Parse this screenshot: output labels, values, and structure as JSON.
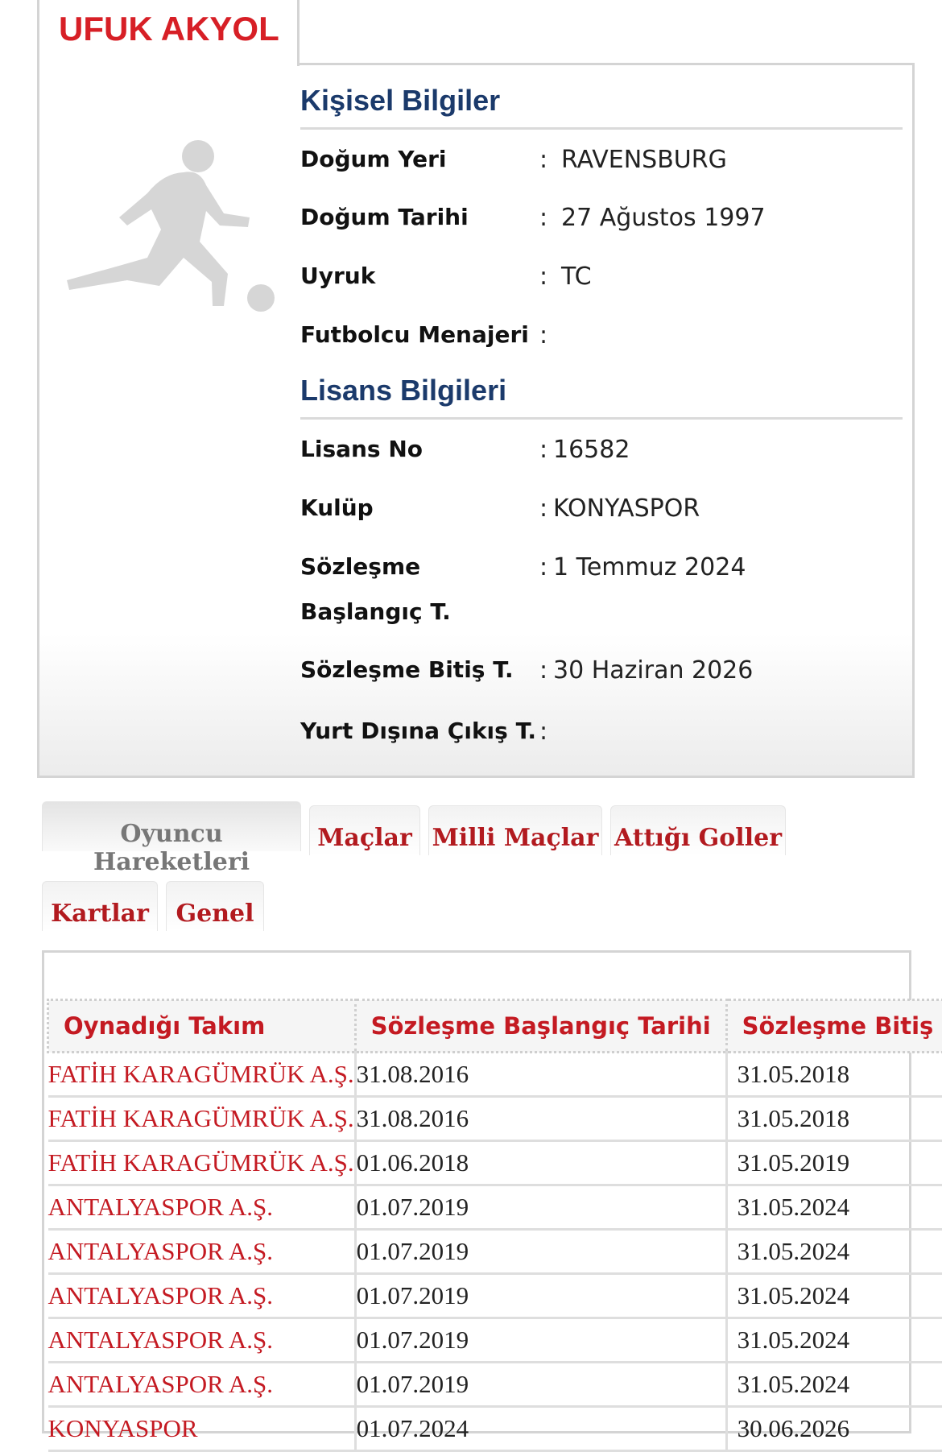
{
  "player": {
    "name": "UFUK AKYOL"
  },
  "personal": {
    "title": "Kişisel Bilgiler",
    "fields": [
      {
        "label": "Doğum Yeri",
        "value": "RAVENSBURG"
      },
      {
        "label": "Doğum Tarihi",
        "value": "27 Ağustos 1997"
      },
      {
        "label": "Uyruk",
        "value": "TC"
      },
      {
        "label": "Futbolcu Menajeri",
        "value": ""
      }
    ]
  },
  "license": {
    "title": "Lisans Bilgileri",
    "fields": [
      {
        "label": "Lisans No",
        "value": "16582"
      },
      {
        "label": "Kulüp",
        "value": "KONYASPOR"
      },
      {
        "label": "Sözleşme Başlangıç T.",
        "value": "1 Temmuz 2024"
      },
      {
        "label": "Sözleşme Bitiş T.",
        "value": "30 Haziran 2026"
      },
      {
        "label": "Yurt Dışına Çıkış T.",
        "value": ""
      }
    ]
  },
  "separator": ":",
  "tabs": [
    "Oyuncu Hareketleri",
    "Maçlar",
    "Milli Maçlar",
    "Attığı Goller",
    "Kartlar",
    "Genel"
  ],
  "active_tab": "Oyuncu Hareketleri",
  "transfers": {
    "headers": [
      "Oynadığı Takım",
      "Sözleşme Başlangıç Tarihi",
      "Sözleşme Bitiş"
    ],
    "rows": [
      [
        "FATİH KARAGÜMRÜK A.Ş.",
        "31.08.2016",
        "31.05.2018"
      ],
      [
        "FATİH KARAGÜMRÜK A.Ş.",
        "31.08.2016",
        "31.05.2018"
      ],
      [
        "FATİH KARAGÜMRÜK A.Ş.",
        "01.06.2018",
        "31.05.2019"
      ],
      [
        "ANTALYASPOR A.Ş.",
        "01.07.2019",
        "31.05.2024"
      ],
      [
        "ANTALYASPOR A.Ş.",
        "01.07.2019",
        "31.05.2024"
      ],
      [
        "ANTALYASPOR A.Ş.",
        "01.07.2019",
        "31.05.2024"
      ],
      [
        "ANTALYASPOR A.Ş.",
        "01.07.2019",
        "31.05.2024"
      ],
      [
        "ANTALYASPOR A.Ş.",
        "01.07.2019",
        "31.05.2024"
      ],
      [
        "KONYASPOR",
        "01.07.2024",
        "30.06.2026"
      ]
    ]
  },
  "colors": {
    "brand_red": "#d71f26",
    "section_blue": "#1b3a6b"
  },
  "icons": {
    "player_image": "player-silhouette-icon"
  }
}
